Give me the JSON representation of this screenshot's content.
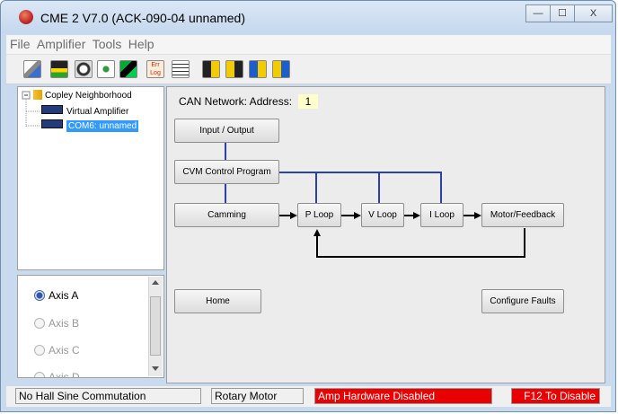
{
  "window": {
    "title": "CME 2 V7.0 (ACK-090-04 unnamed)",
    "controls": {
      "minimize": "—",
      "maximize": "☐",
      "close": "X"
    }
  },
  "menu": [
    "File",
    "Amplifier",
    "Tools",
    "Help"
  ],
  "toolbar": [
    {
      "icon": "amplifier-settings-icon"
    },
    {
      "icon": "control-panel-icon"
    },
    {
      "icon": "motor-icon"
    },
    {
      "icon": "tuning-icon"
    },
    {
      "icon": "scope-icon"
    },
    {
      "icon": "error-log-icon",
      "label": "Err Log"
    },
    {
      "icon": "notes-icon"
    },
    {
      "icon": "save-to-flash-icon"
    },
    {
      "icon": "restore-from-flash-icon"
    },
    {
      "icon": "save-to-disk-icon"
    },
    {
      "icon": "restore-from-disk-icon"
    }
  ],
  "tree": {
    "root": "Copley Neighborhood",
    "children": [
      "Virtual Amplifier",
      "COM6: unnamed"
    ]
  },
  "axes": [
    {
      "label": "Axis A",
      "selected": true
    },
    {
      "label": "Axis B",
      "selected": false
    },
    {
      "label": "Axis C",
      "selected": false
    },
    {
      "label": "Axis D",
      "selected": false
    }
  ],
  "can": {
    "label": "CAN Network:  Address:",
    "address": "1"
  },
  "blocks": {
    "input_output": "Input / Output",
    "cvm": "CVM Control Program",
    "camming": "Camming",
    "p_loop": "P Loop",
    "v_loop": "V Loop",
    "i_loop": "I Loop",
    "motor_feedback": "Motor/Feedback",
    "home": "Home",
    "configure_faults": "Configure Faults"
  },
  "status": {
    "commutation": "No Hall Sine Commutation",
    "motor": "Rotary Motor",
    "amp": "Amp Hardware Disabled",
    "f12": "F12 To Disable"
  },
  "colors": {
    "link_blue": "#2d3fa8",
    "alert_red": "#e80000",
    "address_bg": "#ffffcc"
  }
}
